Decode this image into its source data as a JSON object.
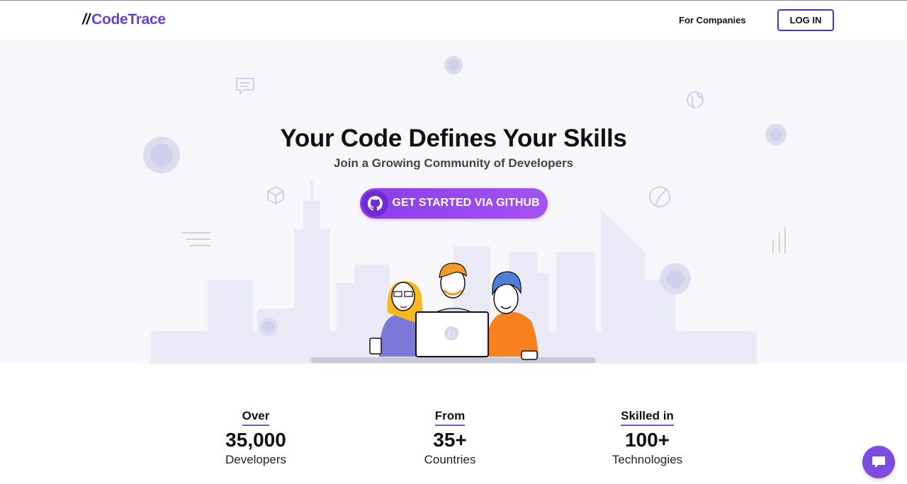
{
  "brand": {
    "slashes": "//",
    "name": "CodeTrace",
    "color": "#6b3fd6"
  },
  "nav": {
    "for_companies": "For Companies",
    "login": "LOG IN"
  },
  "hero": {
    "title": "Your Code Defines Your Skills",
    "subtitle": "Join a Growing Community of Developers",
    "cta": "GET STARTED VIA GITHUB",
    "cta_icon": "github-icon",
    "laptop_symbol": "{}"
  },
  "stats": [
    {
      "prefix": "Over",
      "value": "35,000",
      "unit": "Developers"
    },
    {
      "prefix": "From",
      "value": "35+",
      "unit": "Countries"
    },
    {
      "prefix": "Skilled in",
      "value": "100+",
      "unit": "Technologies"
    }
  ],
  "chat": {
    "icon": "chat-bubble-icon"
  },
  "colors": {
    "accent": "#7c4be0",
    "hero_bg": "#f6f6fb",
    "skyline": "#eaeaf5"
  }
}
